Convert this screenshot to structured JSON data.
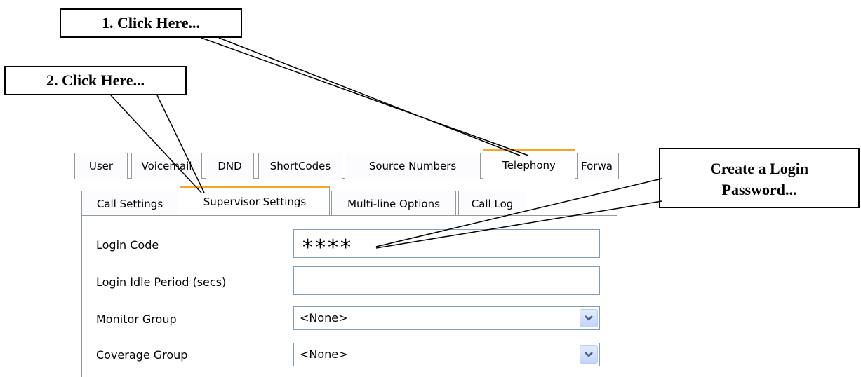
{
  "callouts": {
    "step1": "1. Click Here...",
    "step2": "2. Click Here...",
    "password_line1": "Create a Login",
    "password_line2": "Password..."
  },
  "main_tabs": [
    "User",
    "Voicemail",
    "DND",
    "ShortCodes",
    "Source Numbers",
    "Telephony",
    "Forwa"
  ],
  "main_tabs_active": "Telephony",
  "sub_tabs": [
    "Call Settings",
    "Supervisor Settings",
    "Multi-line Options",
    "Call Log"
  ],
  "sub_tabs_active": "Supervisor Settings",
  "form": {
    "login_code_label": "Login Code",
    "login_code_value": "****",
    "idle_label": "Login Idle Period (secs)",
    "idle_value": "",
    "monitor_label": "Monitor Group",
    "monitor_value": "<None>",
    "coverage_label": "Coverage Group",
    "coverage_value": "<None>"
  },
  "colors": {
    "active_tab_accent": "#f5a623",
    "border": "#919b9c",
    "field_border": "#7f9db9"
  },
  "icons": {
    "dropdown": "chevron-down-icon"
  }
}
